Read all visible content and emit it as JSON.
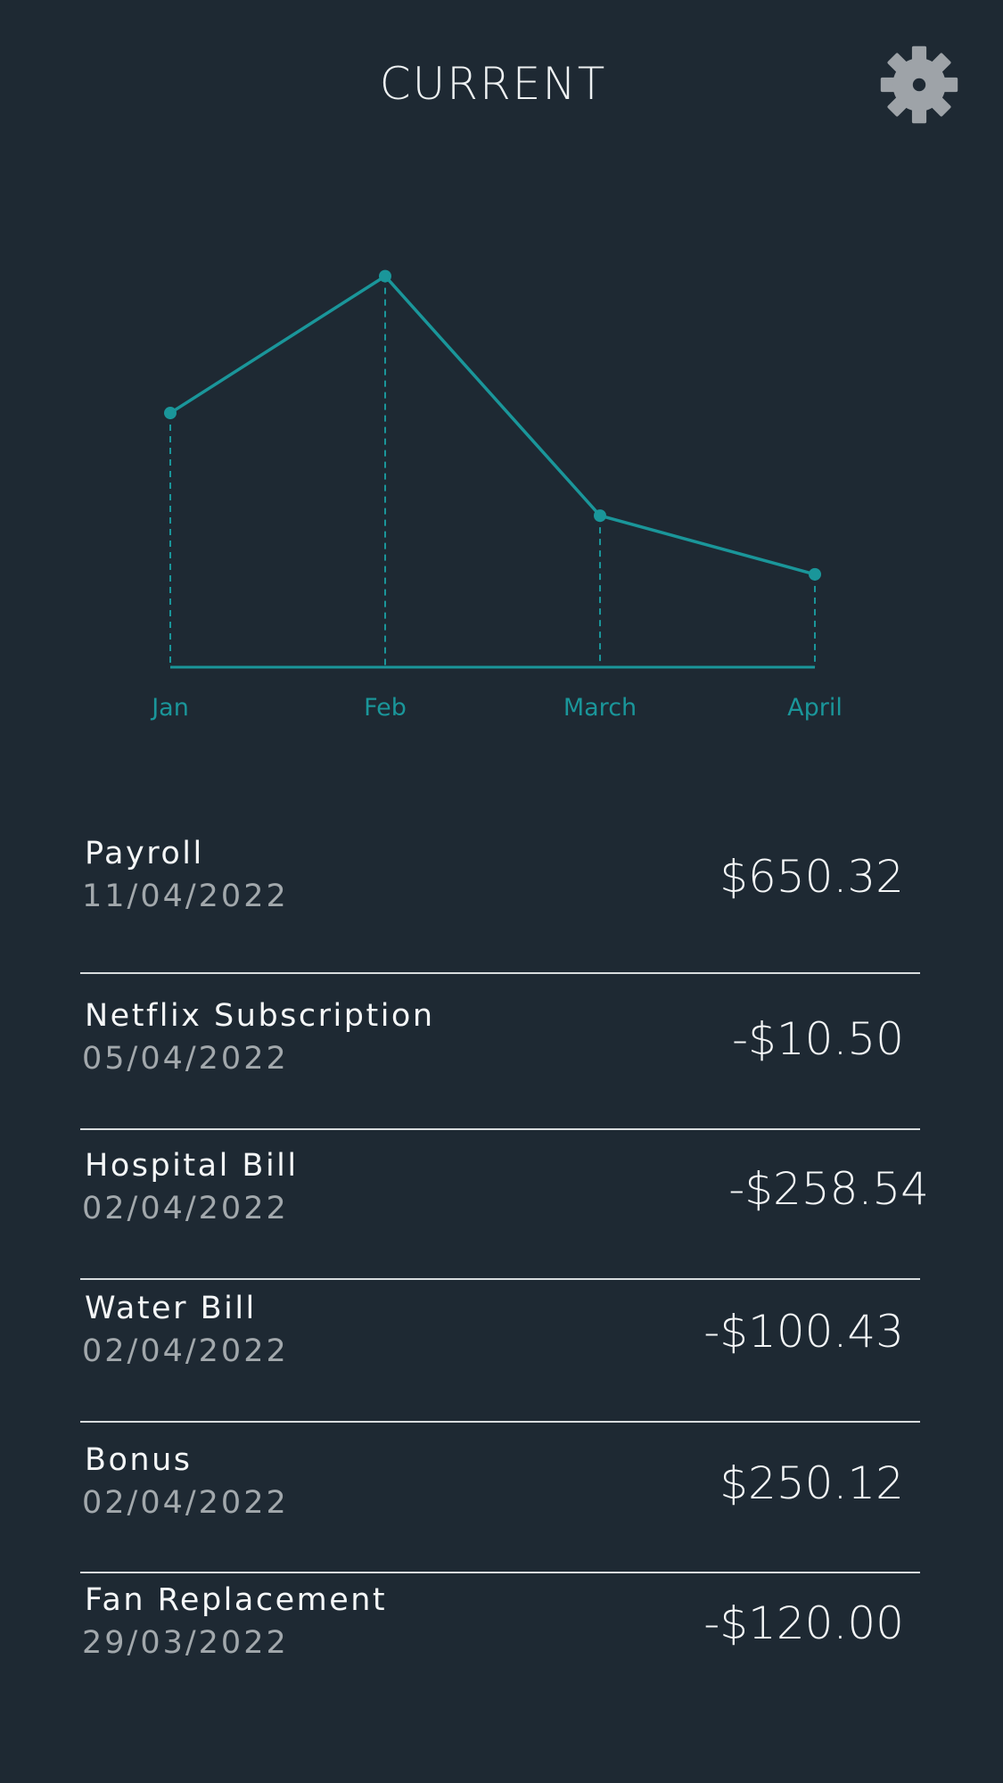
{
  "header": {
    "title": "CURRENT",
    "settings_icon": "gear-icon"
  },
  "colors": {
    "background": "#1e2933",
    "accent": "#1a969a",
    "gear": "#9ea3a8",
    "divider": "#d8dcde",
    "secondary_text": "#a2a8ac"
  },
  "chart_data": {
    "type": "line",
    "categories": [
      "Jan",
      "Feb",
      "March",
      "April"
    ],
    "values": [
      52,
      80,
      31,
      19
    ],
    "ylim": [
      0,
      100
    ],
    "markers": true,
    "drop_lines": true,
    "y_axis_visible": false,
    "grid": false
  },
  "transactions": [
    {
      "name": "Payroll",
      "date": "11/04/2022",
      "amount": "$650.32"
    },
    {
      "name": "Netflix Subscription",
      "date": "05/04/2022",
      "amount": "-$10.50"
    },
    {
      "name": "Hospital Bill",
      "date": "02/04/2022",
      "amount": "-$258.54"
    },
    {
      "name": "Water Bill",
      "date": "02/04/2022",
      "amount": "-$100.43"
    },
    {
      "name": "Bonus",
      "date": "02/04/2022",
      "amount": "$250.12"
    },
    {
      "name": "Fan Replacement",
      "date": "29/03/2022",
      "amount": "-$120.00"
    }
  ]
}
